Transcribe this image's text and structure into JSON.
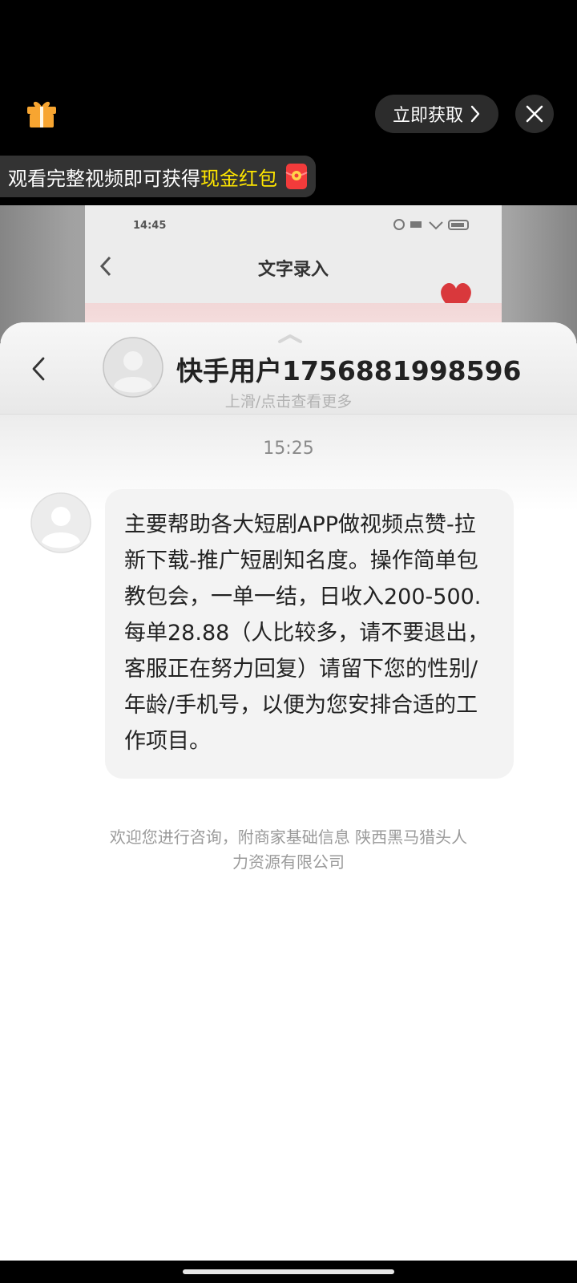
{
  "ad_bar": {
    "get_label": "立即获取",
    "promo_text_prefix": "观看完整视频即可获得",
    "promo_text_highlight": "现金红包"
  },
  "video_frame": {
    "status_time": "14:45",
    "title": "文字录入"
  },
  "chat": {
    "title": "快手用户1756881998596",
    "hint": "上滑/点击查看更多",
    "timestamp": "15:25",
    "message": "主要帮助各大短剧APP做视频点赞-拉新下载-推广短剧知名度。操作简单包教包会，一单一结，日收入200-500.每单28.88（人比较多，请不要退出，客服正在努力回复）请留下您的性别/年龄/手机号，以便为您安排合适的工作项目。",
    "footer_note": "欢迎您进行咨询，附商家基础信息 陕西黑马猎头人力资源有限公司"
  },
  "colors": {
    "highlight": "#ffe600",
    "bubble": "#f3f3f3",
    "gift": "#f7a531"
  },
  "icons": [
    "gift-icon",
    "chevron-right-icon",
    "close-icon",
    "red-packet-icon",
    "back-arrow-icon",
    "avatar-icon",
    "pull-up-icon",
    "heart-icon"
  ]
}
